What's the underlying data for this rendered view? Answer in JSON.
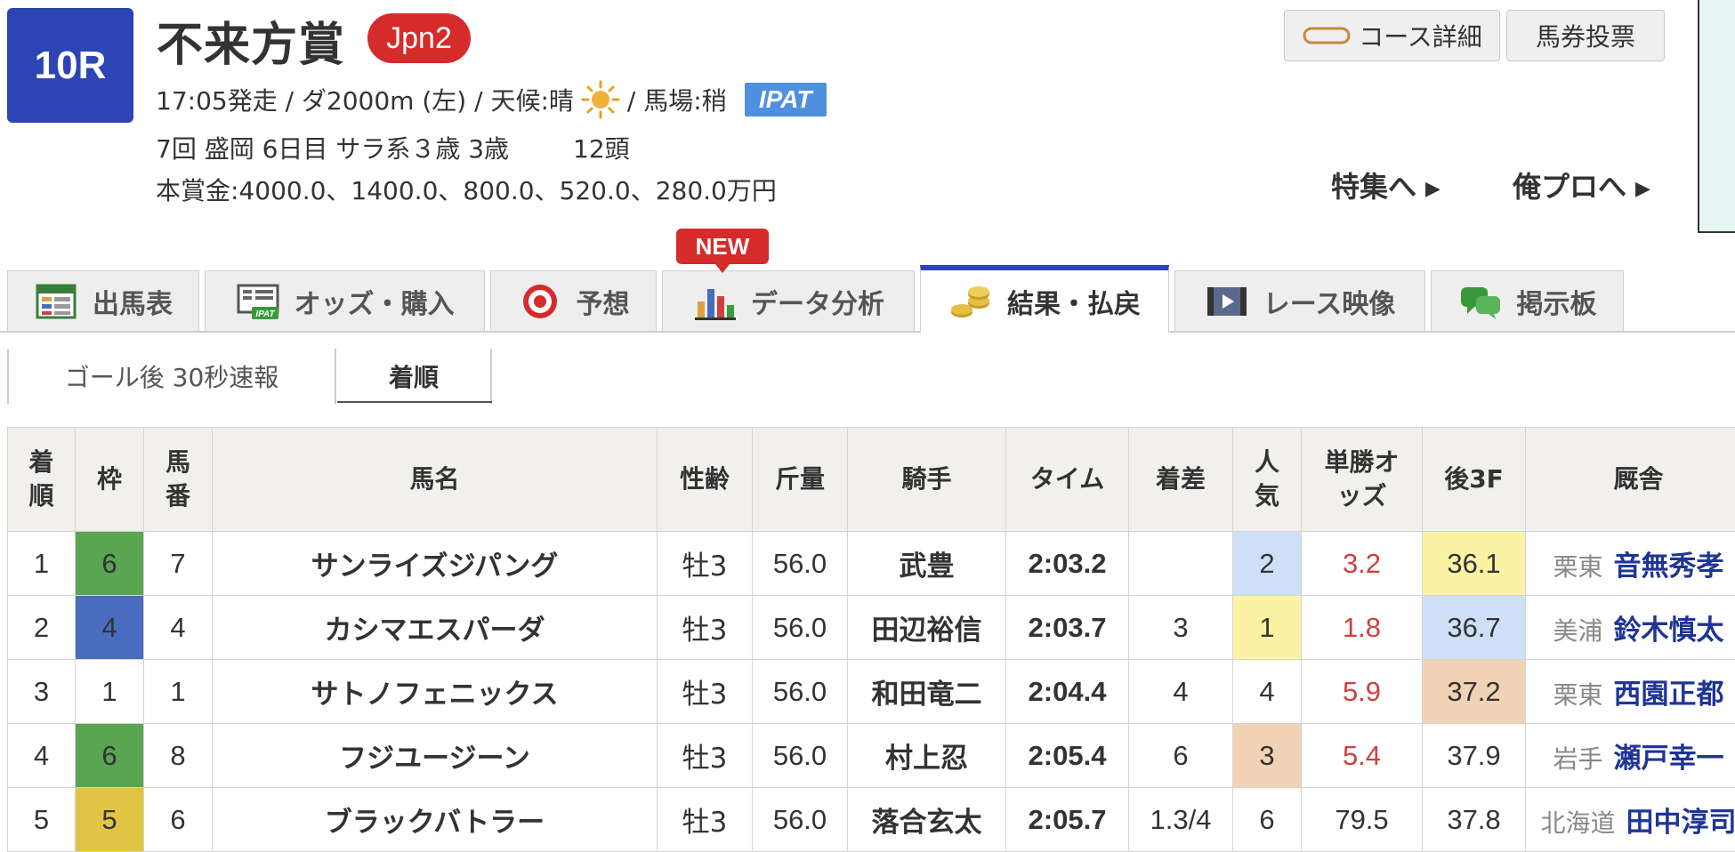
{
  "race": {
    "number": "10R",
    "name": "不来方賞",
    "grade": "Jpn2",
    "line1_prefix": "17:05発走 / ダ2000m (左) / 天候:晴",
    "line1_suffix": "/ 馬場:稍",
    "ipat": "IPAT",
    "meeting": "7回 盛岡 6日目 サラ系３歳 3歳",
    "heads": "12頭",
    "prize": "本賞金:4000.0、1400.0、800.0、520.0、280.0万円",
    "weather_icon": "sun-icon"
  },
  "header_buttons": {
    "course_detail": "コース詳細",
    "bet": "馬券投票"
  },
  "links": {
    "tokushu": "特集へ",
    "orepro": "俺プロへ"
  },
  "new_badge": "NEW",
  "tabs": [
    {
      "label": "出馬表",
      "icon": "race-card-icon"
    },
    {
      "label": "オッズ・購入",
      "icon": "odds-ipat-icon"
    },
    {
      "label": "予想",
      "icon": "target-icon"
    },
    {
      "label": "データ分析",
      "icon": "bar-chart-icon"
    },
    {
      "label": "結果・払戻",
      "icon": "coins-icon",
      "active": true
    },
    {
      "label": "レース映像",
      "icon": "video-icon"
    },
    {
      "label": "掲示板",
      "icon": "chat-icon"
    }
  ],
  "subtabs": [
    {
      "label": "ゴール後 30秒速報"
    },
    {
      "label": "着順",
      "active": true
    }
  ],
  "columns": {
    "rank": "着順",
    "frame": "枠",
    "number": "馬番",
    "horse": "馬名",
    "sex_age": "性齢",
    "weight": "斤量",
    "jockey": "騎手",
    "time": "タイム",
    "margin": "着差",
    "popularity": "人気",
    "odds": "単勝オッズ",
    "last3f": "後3F",
    "stable": "厩舎"
  },
  "results": [
    {
      "rank": "1",
      "frame": "6",
      "frame_color": "#5aa552",
      "number": "7",
      "horse": "サンライズジパング",
      "sex_age": "牡3",
      "weight": "56.0",
      "jockey": "武豊",
      "time": "2:03.2",
      "margin": "",
      "popularity": "2",
      "odds": "3.2",
      "last3f": "36.1",
      "region": "栗東",
      "trainer": "音無秀孝"
    },
    {
      "rank": "2",
      "frame": "4",
      "frame_color": "#4a6cbf",
      "number": "4",
      "horse": "カシマエスパーダ",
      "sex_age": "牡3",
      "weight": "56.0",
      "jockey": "田辺裕信",
      "time": "2:03.7",
      "margin": "3",
      "popularity": "1",
      "odds": "1.8",
      "last3f": "36.7",
      "region": "美浦",
      "trainer": "鈴木慎太"
    },
    {
      "rank": "3",
      "frame": "1",
      "frame_color": "#ffffff",
      "number": "1",
      "horse": "サトノフェニックス",
      "sex_age": "牡3",
      "weight": "56.0",
      "jockey": "和田竜二",
      "time": "2:04.4",
      "margin": "4",
      "popularity": "4",
      "odds": "5.9",
      "last3f": "37.2",
      "region": "栗東",
      "trainer": "西園正都"
    },
    {
      "rank": "4",
      "frame": "6",
      "frame_color": "#5aa552",
      "number": "8",
      "horse": "フジユージーン",
      "sex_age": "牡3",
      "weight": "56.0",
      "jockey": "村上忍",
      "time": "2:05.4",
      "margin": "6",
      "popularity": "3",
      "odds": "5.4",
      "last3f": "37.9",
      "region": "岩手",
      "trainer": "瀬戸幸一"
    },
    {
      "rank": "5",
      "frame": "5",
      "frame_color": "#e0c545",
      "number": "6",
      "horse": "ブラックバトラー",
      "sex_age": "牡3",
      "weight": "56.0",
      "jockey": "落合玄太",
      "time": "2:05.7",
      "margin": "1.3/4",
      "popularity": "6",
      "odds": "79.5",
      "last3f": "37.8",
      "region": "北海道",
      "trainer": "田中淳司"
    }
  ],
  "colors": {
    "race_badge": "#2c44b4",
    "grade_badge": "#d52b2b",
    "link_blue": "#1f3596",
    "odds_red": "#d04040",
    "highlight_blue": "#cfdff8",
    "highlight_yellow": "#fbf3a3",
    "highlight_orange": "#f1d2b4"
  }
}
